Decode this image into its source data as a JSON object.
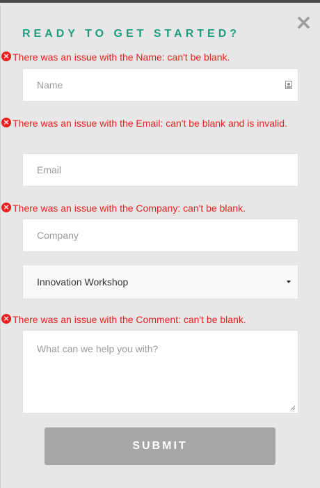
{
  "header": {
    "title": "READY TO GET STARTED?",
    "close_icon": "×"
  },
  "form": {
    "name": {
      "error": "There was an issue with the Name: can't be blank.",
      "placeholder": "Name",
      "value": ""
    },
    "email": {
      "error": "There was an issue with the Email: can't be blank and is invalid.",
      "placeholder": "Email",
      "value": ""
    },
    "company": {
      "error": "There was an issue with the Company: can't be blank.",
      "placeholder": "Company",
      "value": ""
    },
    "interest": {
      "selected": "Innovation Workshop"
    },
    "comment": {
      "error": "There was an issue with the Comment: can't be blank.",
      "placeholder": "What can we help you with?",
      "value": ""
    },
    "submit_label": "SUBMIT"
  },
  "icons": {
    "error_icon": "×",
    "error_color": "#e8201f",
    "accent_color": "#1e9d7f"
  }
}
